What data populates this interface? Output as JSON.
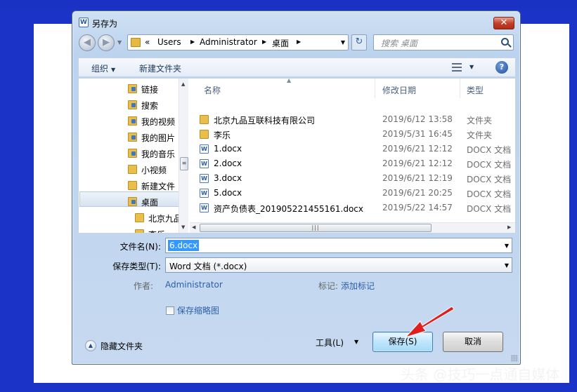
{
  "window": {
    "title": "另存为",
    "close_glyph": "✕"
  },
  "address": {
    "overflow": "«",
    "crumbs": [
      "Users",
      "Administrator",
      "桌面"
    ],
    "refresh_glyph": "↻"
  },
  "search": {
    "placeholder": "搜索 桌面"
  },
  "toolbar": {
    "organize_label": "组织",
    "new_folder_label": "新建文件夹",
    "help_glyph": "?"
  },
  "nav_pane": {
    "items": [
      {
        "label": "链接",
        "icon": "link-folder-icon"
      },
      {
        "label": "搜索",
        "icon": "search-folder-icon"
      },
      {
        "label": "我的视频",
        "icon": "videos-folder-icon"
      },
      {
        "label": "我的图片",
        "icon": "pictures-folder-icon"
      },
      {
        "label": "我的音乐",
        "icon": "music-folder-icon"
      },
      {
        "label": "小视频",
        "icon": "folder-icon"
      },
      {
        "label": "新建文件",
        "icon": "folder-icon"
      },
      {
        "label": "桌面",
        "icon": "desktop-folder-icon",
        "selected": true
      },
      {
        "label": "北京九品",
        "icon": "folder-icon"
      },
      {
        "label": "李乐",
        "icon": "folder-icon"
      }
    ]
  },
  "file_list": {
    "columns": [
      "名称",
      "修改日期",
      "类型"
    ],
    "rows": [
      {
        "name": "北京九品互联科技有限公司",
        "date": "2019/6/12 13:58",
        "type": "文件夹",
        "icon": "folder-icon"
      },
      {
        "name": "李乐",
        "date": "2019/5/31 16:45",
        "type": "文件夹",
        "icon": "folder-icon"
      },
      {
        "name": "1.docx",
        "date": "2019/6/21 12:12",
        "type": "DOCX 文档",
        "icon": "word-doc-icon"
      },
      {
        "name": "2.docx",
        "date": "2019/6/21 12:12",
        "type": "DOCX 文档",
        "icon": "word-doc-icon"
      },
      {
        "name": "3.docx",
        "date": "2019/6/21 12:19",
        "type": "DOCX 文档",
        "icon": "word-doc-icon"
      },
      {
        "name": "5.docx",
        "date": "2019/6/21 20:25",
        "type": "DOCX 文档",
        "icon": "word-doc-icon"
      },
      {
        "name": "资产负债表_201905221455161.docx",
        "date": "2019/5/22 14:57",
        "type": "DOCX 文档",
        "icon": "word-doc-icon"
      }
    ]
  },
  "form": {
    "filename_label": "文件名(N):",
    "filename_value": "6.docx",
    "filetype_label": "保存类型(T):",
    "filetype_value": "Word 文档 (*.docx)",
    "author_label": "作者:",
    "author_value": "Administrator",
    "tags_label": "标记:",
    "tags_value": "添加标记",
    "thumbnail_label": "保存缩略图",
    "thumbnail_checked": false
  },
  "footer": {
    "hide_folders_label": "隐藏文件夹",
    "tools_label": "工具(L)",
    "save_label": "保存(S)",
    "cancel_label": "取消"
  },
  "overlay": {
    "watermark": "头条 @技巧一点通自媒体",
    "arrow_color": "#e02020"
  },
  "colors": {
    "desktop_blue": "#1c33c8",
    "link_blue": "#2d5fa8",
    "selection_blue": "#3399ff"
  }
}
